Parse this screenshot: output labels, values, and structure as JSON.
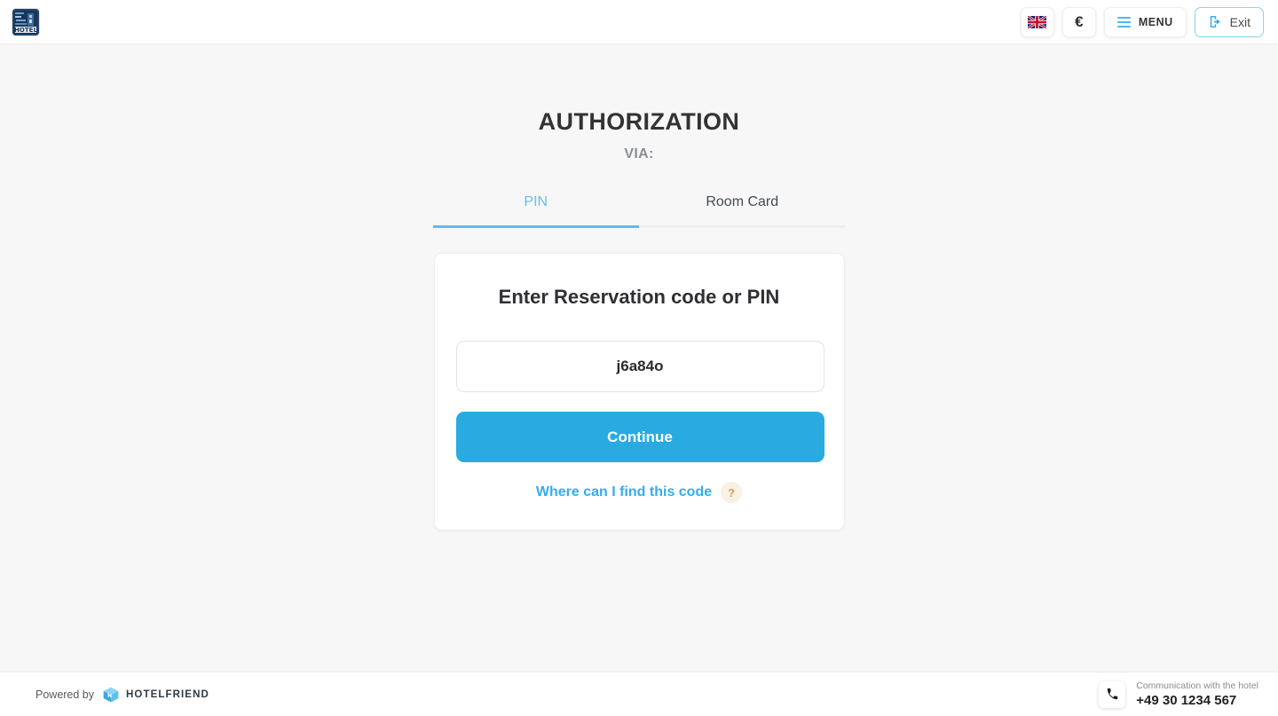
{
  "header": {
    "logo_alt": "hotel-logo",
    "language_flag": "uk-flag-icon",
    "currency_symbol": "€",
    "menu_label": "MENU",
    "exit_label": "Exit"
  },
  "main": {
    "title": "AUTHORIZATION",
    "subtitle": "VIA:",
    "tabs": [
      {
        "label": "PIN",
        "active": true
      },
      {
        "label": "Room Card",
        "active": false
      }
    ],
    "card": {
      "title": "Enter Reservation code or PIN",
      "input_value": "j6a84o",
      "input_placeholder": "Reservation code or PIN",
      "continue_label": "Continue",
      "help_label": "Where can I find this code",
      "help_badge": "?"
    }
  },
  "footer": {
    "powered_by_label": "Powered by",
    "brand_name": "HOTELFRIEND",
    "contact_label": "Communication with the hotel",
    "contact_number": "+49 30 1234 567"
  },
  "colors": {
    "accent_blue": "#29abe2",
    "tab_active": "#5bbfe6",
    "link_blue": "#35acea",
    "page_bg": "#f7f7f8",
    "help_badge_bg": "#f8f1e4",
    "help_badge_fg": "#d4a24a"
  }
}
